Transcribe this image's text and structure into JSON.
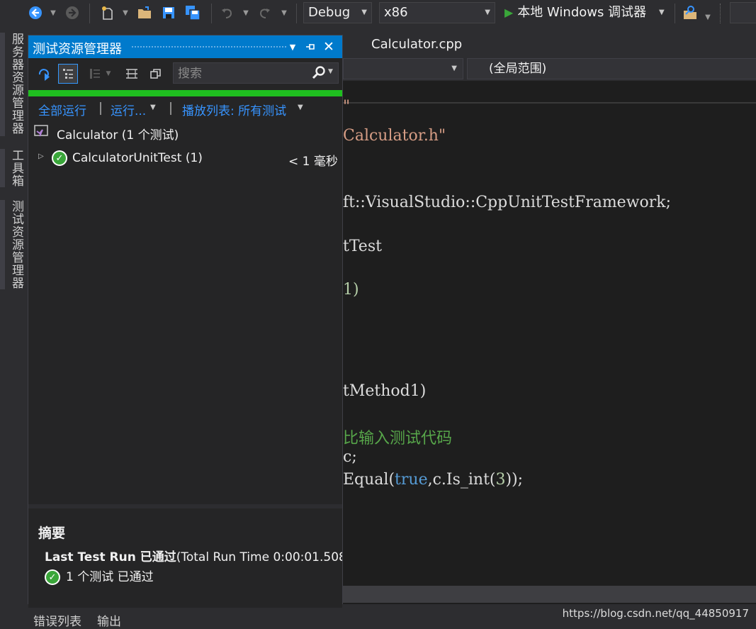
{
  "toolbar": {
    "config": "Debug",
    "platform": "x86",
    "run_label": "本地 Windows 调试器"
  },
  "left_tabs": [
    "服务器资源管理器",
    "工具箱",
    "测试资源管理器"
  ],
  "editor": {
    "tab": "Calculator.cpp",
    "scope": "(全局范围)",
    "lines": {
      "l1": "\"",
      "l2": "Calculator.h\"",
      "l3": "ft::VisualStudio::CppUnitTestFramework;",
      "l4": "tTest",
      "l5": "1)",
      "l6": "tMethod1)",
      "l7": "比输入测试代码",
      "l8": "c;",
      "l9_a": "Equal(",
      "l9_kw": "true",
      "l9_b": ",c.Is_int(",
      "l9_num": "3",
      "l9_c": "));"
    }
  },
  "panel": {
    "title": "测试资源管理器",
    "search_placeholder": "搜索",
    "run_all": "全部运行",
    "run": "运行...",
    "playlist": "播放列表: 所有测试",
    "project": "Calculator (1 个测试)",
    "test_class": "CalculatorUnitTest (1)",
    "duration": "< 1 毫秒",
    "summary_title": "摘要",
    "last_run_label": "Last Test Run 已通过",
    "last_run_time": "(Total Run Time 0:00:01.508",
    "passed": "1 个测试 已通过"
  },
  "bottom_tabs": [
    "错误列表",
    "输出"
  ],
  "watermark": "https://blog.csdn.net/qq_44850917",
  "colors": {
    "accent": "#007acc",
    "progress": "#1fbf1f",
    "link": "#3794ff",
    "pass": "#3aa63a"
  }
}
